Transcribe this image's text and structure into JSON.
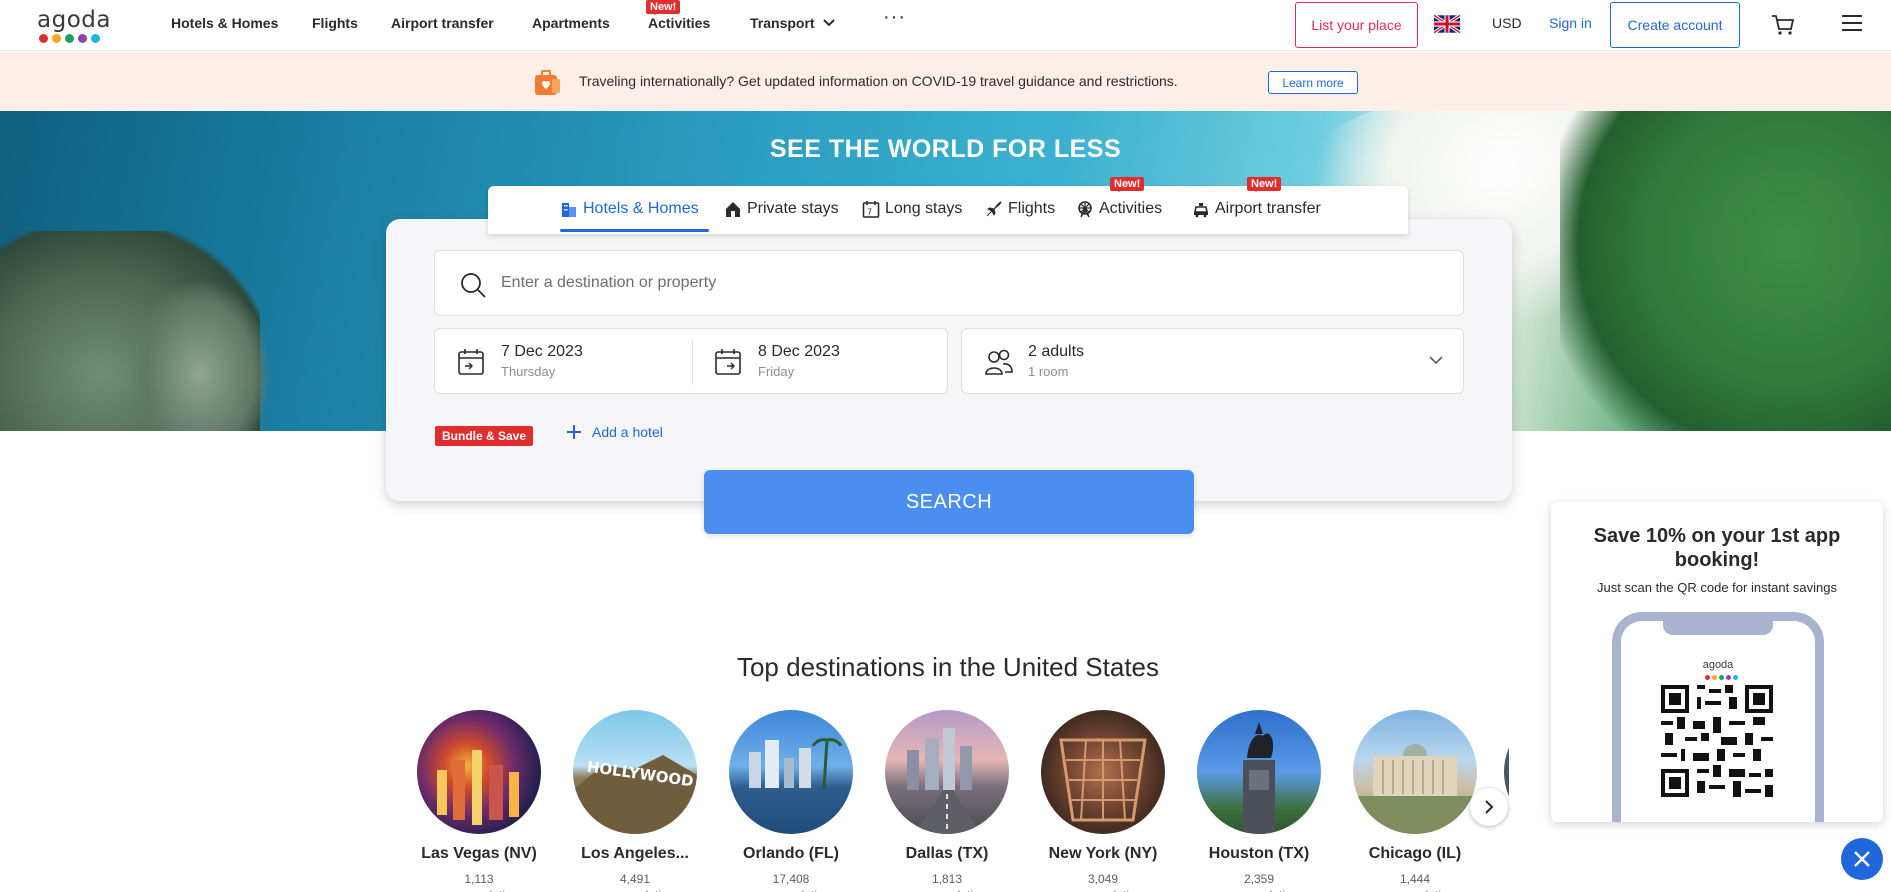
{
  "header": {
    "logo_text": "agoda",
    "logo_colors": [
      "#e12d2d",
      "#f5a623",
      "#1aa260",
      "#8e44ad",
      "#2067da",
      "#1fb6e3"
    ],
    "nav": [
      {
        "label": "Hotels & Homes"
      },
      {
        "label": "Flights"
      },
      {
        "label": "Airport transfer"
      },
      {
        "label": "Apartments"
      },
      {
        "label": "Activities",
        "badge": "New!"
      },
      {
        "label": "Transport"
      }
    ],
    "more_label": "···",
    "list_place": "List your place",
    "currency": "USD",
    "sign_in": "Sign in",
    "create_account": "Create account"
  },
  "covid_banner": {
    "text": "Traveling internationally? Get updated information on COVID-19 travel guidance and restrictions.",
    "button": "Learn more"
  },
  "hero": {
    "title": "SEE THE WORLD FOR LESS"
  },
  "tabs": [
    {
      "label": "Hotels & Homes",
      "icon": "building-icon",
      "active": true
    },
    {
      "label": "Private stays",
      "icon": "house-icon"
    },
    {
      "label": "Long stays",
      "icon": "calendar-7-icon"
    },
    {
      "label": "Flights",
      "icon": "plane-icon"
    },
    {
      "label": "Activities",
      "icon": "ferris-wheel-icon",
      "badge": "New!"
    },
    {
      "label": "Airport transfer",
      "icon": "car-icon",
      "badge": "New!"
    }
  ],
  "search": {
    "destination_placeholder": "Enter a destination or property",
    "checkin_date": "7 Dec 2023",
    "checkin_day": "Thursday",
    "checkout_date": "8 Dec 2023",
    "checkout_day": "Friday",
    "guests": "2 adults",
    "rooms": "1 room",
    "bundle_label": "Bundle & Save",
    "add_hotel": "Add a hotel",
    "button": "SEARCH"
  },
  "destinations": {
    "title": "Top destinations in the United States",
    "cities": [
      {
        "name": "Las Vegas (NV)",
        "count": "1,113",
        "accom": "accommodations"
      },
      {
        "name": "Los Angeles...",
        "count": "4,491",
        "accom": "accommodations"
      },
      {
        "name": "Orlando (FL)",
        "count": "17,408",
        "accom": "accommodations"
      },
      {
        "name": "Dallas (TX)",
        "count": "1,813",
        "accom": "accommodations"
      },
      {
        "name": "New York (NY)",
        "count": "3,049",
        "accom": "accommodations"
      },
      {
        "name": "Houston (TX)",
        "count": "2,359",
        "accom": "accommodations"
      },
      {
        "name": "Chicago (IL)",
        "count": "1,444",
        "accom": "accommodations"
      }
    ]
  },
  "promo": {
    "title": "Save 10% on your 1st app booking!",
    "subtitle": "Just scan the QR code for instant savings",
    "phone_logo": "agoda"
  },
  "colors": {
    "brand_blue": "#2067da",
    "search_button": "#4a8ff0",
    "badge_red": "#e12d2d",
    "list_place_pink": "#e12d58",
    "banner_bg": "#fdeee8"
  }
}
